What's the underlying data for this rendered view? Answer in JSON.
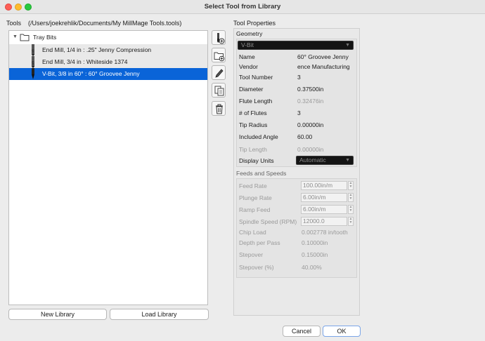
{
  "window": {
    "title": "Select Tool from Library"
  },
  "tools": {
    "label": "Tools",
    "path": "(/Users/joekrehlik/Documents/My MillMage Tools.tools)",
    "folder": {
      "name": "Tray Bits",
      "expanded": true
    },
    "items": [
      {
        "label": "End Mill, 1/4 in : .25\" Jenny Compression",
        "selected": false
      },
      {
        "label": "End Mill, 3/4 in : Whiteside 1374",
        "selected": false
      },
      {
        "label": "V-Bit, 3/8 in 60° : 60° Groovee Jenny",
        "selected": true
      }
    ],
    "side_buttons": [
      "new-tool-icon",
      "new-folder-icon",
      "edit-icon",
      "copy-icon",
      "delete-icon"
    ],
    "new_library_label": "New Library",
    "load_library_label": "Load Library"
  },
  "properties": {
    "header": "Tool Properties",
    "geometry": {
      "title": "Geometry",
      "type_select": "V-Bit",
      "name_label": "Name",
      "name_value": "60° Groovee Jenny",
      "vendor_label": "Vendor",
      "vendor_value": "ence Manufacturing",
      "tool_number_label": "Tool Number",
      "tool_number_value": "3",
      "diameter_label": "Diameter",
      "diameter_value": "0.37500in",
      "flute_length_label": "Flute Length",
      "flute_length_value": "0.32476in",
      "flutes_label": "# of Flutes",
      "flutes_value": "3",
      "tip_radius_label": "Tip Radius",
      "tip_radius_value": "0.00000in",
      "included_angle_label": "Included Angle",
      "included_angle_value": "60.00",
      "tip_length_label": "Tip Length",
      "tip_length_value": "0.00000in",
      "display_units_label": "Display Units",
      "display_units_value": "Automatic"
    },
    "feeds": {
      "title": "Feeds and Speeds",
      "feed_rate_label": "Feed Rate",
      "feed_rate_value": "100.00in/m",
      "plunge_rate_label": "Plunge Rate",
      "plunge_rate_value": "6.00in/m",
      "ramp_feed_label": "Ramp Feed",
      "ramp_feed_value": "6.00in/m",
      "spindle_label": "Spindle Speed (RPM)",
      "spindle_value": "12000.0",
      "chip_load_label": "Chip Load",
      "chip_load_value": "0.002778 in/tooth",
      "depth_label": "Depth per Pass",
      "depth_value": "0.10000in",
      "stepover_label": "Stepover",
      "stepover_value": "0.15000in",
      "stepover_pct_label": "Stepover (%)",
      "stepover_pct_value": "40.00%"
    }
  },
  "footer": {
    "cancel_label": "Cancel",
    "ok_label": "OK"
  },
  "colors": {
    "selection": "#0a64d8",
    "close": "#fe5f57",
    "minimize": "#febc2e",
    "maximize": "#28c840"
  }
}
